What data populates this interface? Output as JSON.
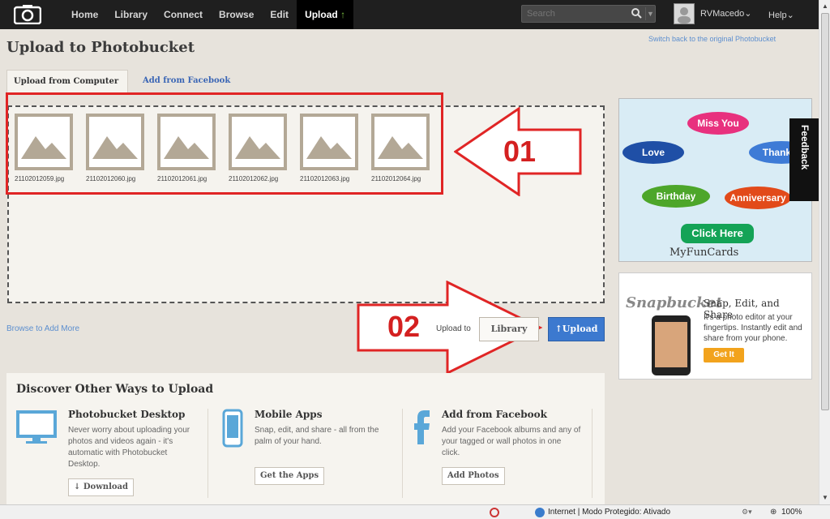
{
  "nav": {
    "items": [
      {
        "label": "Home"
      },
      {
        "label": "Library"
      },
      {
        "label": "Connect"
      },
      {
        "label": "Browse"
      },
      {
        "label": "Edit"
      }
    ],
    "upload_label": "Upload",
    "upload_arrow": "↑",
    "search_placeholder": "Search",
    "username": "RVMacedo",
    "help": "Help"
  },
  "header": {
    "switch_link": "Switch back to the original Photobucket",
    "title": "Upload to Photobucket"
  },
  "tabs": {
    "computer": "Upload from Computer",
    "facebook": "Add from Facebook"
  },
  "files": [
    "21102012059.jpg",
    "21102012060.jpg",
    "21102012061.jpg",
    "21102012062.jpg",
    "21102012063.jpg",
    "21102012064.jpg"
  ],
  "annotations": {
    "label_01": "01",
    "label_02": "02",
    "color": "#d42020"
  },
  "actions": {
    "browse_more": "Browse to Add More",
    "upload_to": "Upload to",
    "library": "Library",
    "upload": "↑Upload"
  },
  "discover": {
    "title": "Discover Other Ways to Upload",
    "columns": [
      {
        "title": "Photobucket Desktop",
        "desc": "Never worry about uploading your photos and videos again - it's automatic with Photobucket Desktop.",
        "button": "↓ Download",
        "icon": "monitor-icon"
      },
      {
        "title": "Mobile Apps",
        "desc": "Snap, edit, and share - all from the palm of your hand.",
        "button": "Get the Apps",
        "icon": "phone-icon"
      },
      {
        "title": "Add from Facebook",
        "desc": "Add your Facebook albums and any of your tagged or wall photos in one click.",
        "button": "Add Photos",
        "icon": "facebook-icon"
      }
    ]
  },
  "ads": {
    "cards": {
      "bubbles": [
        "Miss You",
        "Love",
        "Thank Y",
        "Birthday",
        "Anniversary"
      ],
      "click_here": "Click Here",
      "brand": "MyFunCards"
    },
    "feedback": "Feedback",
    "snap": {
      "logo": "Snapbucket",
      "title": "Snap, Edit, and Share",
      "desc": "It's a photo editor at your fingertips. Instantly edit and share from your phone.",
      "button": "Get It"
    }
  },
  "statusbar": {
    "zone": "Internet | Modo Protegido: Ativado",
    "zoom": "100%"
  }
}
